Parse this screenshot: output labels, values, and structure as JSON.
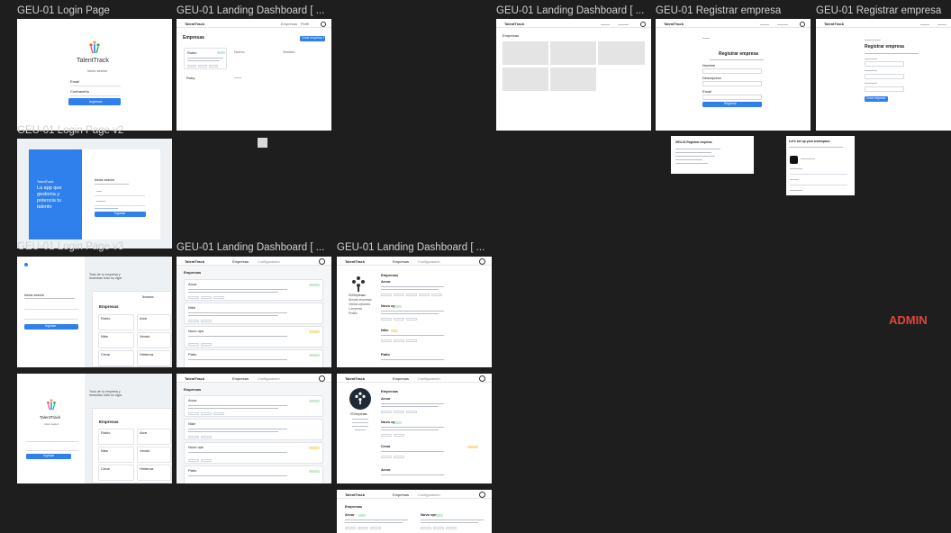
{
  "canvas": {
    "background": "#1e1e1e",
    "admin_label": "ADMIN",
    "admin_color": "#e0463c"
  },
  "frames": {
    "login": {
      "label": "GEU-01 Login Page",
      "logo_text": "TalentTrack",
      "subtitle": "Inicio sesión",
      "email_label": "Email",
      "password_label": "Contraseña",
      "button": "Ingresar"
    },
    "landing1": {
      "label": "GEU-01 Landing Dashboard [ ...",
      "brand": "TalentTrack",
      "nav": [
        "Empresas",
        "Perfil"
      ],
      "heading": "Empresas",
      "new_button": "Crear empresa +",
      "card_title": "Rubio",
      "col2": "Nuevo",
      "col3": "Sentido",
      "row2": "Ruby"
    },
    "landing2": {
      "label": "GEU-01 Landing Dashboard [ ...",
      "brand": "TalentTrack",
      "heading": "Empresas"
    },
    "registrar1": {
      "label": "GEU-01 Registrar empresa",
      "brand": "TalentTrack",
      "heading": "Registrar empresa",
      "f1": "Nombre",
      "f2": "Descripción",
      "f3": "Email",
      "button": "Registrar"
    },
    "registrar2": {
      "label": "GEU-01 Registrar empresa",
      "brand": "TalentTrack",
      "heading": "Registrar empresa",
      "button": "Crear empresa"
    },
    "small1": {
      "title": "GEU-01 Registrar empresa"
    },
    "small2": {
      "title": "Let's set up your workspace"
    },
    "loginv2": {
      "label": "GEU-01 Login Page v2",
      "brand": "TalentTrack",
      "tagline": "La app que gestiona y potencia tu talento",
      "heading": "Inicia sesión",
      "button": "Ingresar"
    },
    "loginv3": {
      "label": "GEU-01 Login Page v3",
      "heading": "Inicia sesión",
      "button": "Ingresar",
      "side_text": "Todo de tu empresa y muestran todo su vigor",
      "panel_heading": "Empresas",
      "panel_tabs": [
        "Nosotros",
        "Configuración"
      ],
      "cards": [
        "Rubio",
        "Arce",
        "Nike",
        "Vendo",
        "Tower",
        "Fiesta",
        "Crear",
        "Hinterna"
      ]
    },
    "loginv4": {
      "logo_text": "TalentTrack",
      "subtitle": "Inicio sesión",
      "button": "Ingresar",
      "side_text": "Todo de tu empresa y muestran todo su vigor",
      "panel_heading": "Empresas",
      "cards": [
        "Rubio",
        "Arce",
        "Nike",
        "Vendo",
        "Tower",
        "Fiesta",
        "Crear",
        "Hinterna"
      ]
    },
    "dash_a": {
      "label": "GEU-01 Landing Dashboard [ ...",
      "brand": "TalentTrack",
      "tabs": [
        "Empresas",
        "Configuración"
      ],
      "heading": "Empresas",
      "items": [
        "Arcor",
        "Nike",
        "Nuvo ops",
        "Patio"
      ]
    },
    "dash_b": {
      "label": "GEU-01 Landing Dashboard [ ...",
      "brand": "TalentTrack",
      "tabs": [
        "Empresas",
        "Configuración"
      ],
      "heading": "Empresas",
      "items": [
        "Arcor",
        "Nike",
        "Nuvo ops",
        "Patio"
      ],
      "side": [
        "20 Empresas",
        "Nuevas empresas",
        "Ofertas laborales",
        "1 empresa",
        "Pedido"
      ]
    },
    "dash_c": {
      "brand": "TalentTrack",
      "tabs": [
        "Empresas",
        "Configuración"
      ],
      "heading": "Empresas",
      "items": [
        "Arcor",
        "Nike",
        "Nuvo ops",
        "Patio"
      ]
    },
    "dash_d": {
      "brand": "TalentTrack",
      "tabs": [
        "Empresas",
        "Configuración"
      ],
      "heading": "Empresas",
      "items": [
        "Arcor",
        "Nuvo ops",
        "Crear",
        "Arcor"
      ],
      "side": [
        "20 Empresas"
      ]
    },
    "dash_e": {
      "brand": "TalentTrack",
      "tabs": [
        "Empresas",
        "Configuración"
      ],
      "heading": "Empresas",
      "items": [
        "Arcor",
        "Nuvo ops"
      ]
    }
  }
}
